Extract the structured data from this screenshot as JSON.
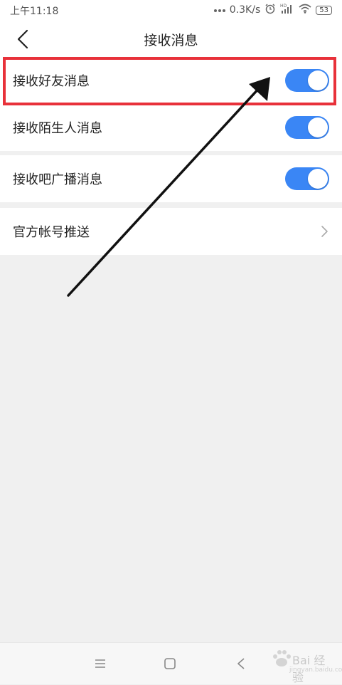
{
  "status_bar": {
    "time": "上午11:18",
    "speed": "0.3K/s",
    "battery": "53",
    "icons": [
      "dots-icon",
      "alarm-icon",
      "hd-signal-icon",
      "wifi-icon",
      "battery-icon"
    ]
  },
  "header": {
    "title": "接收消息",
    "back_icon": "chevron-left-icon"
  },
  "settings": [
    {
      "label": "接收好友消息",
      "control": "toggle",
      "checked": true
    },
    {
      "label": "接收陌生人消息",
      "control": "toggle",
      "checked": true
    },
    {
      "label": "接收吧广播消息",
      "control": "toggle",
      "checked": true
    },
    {
      "label": "官方帐号推送",
      "control": "chevron",
      "icon": "chevron-right-icon"
    }
  ],
  "annotation": {
    "highlight_color": "#e8313a",
    "arrow_color": "#111111"
  },
  "bottom_nav": {
    "icons": [
      "menu-icon",
      "home-square-icon",
      "back-triangle-icon"
    ]
  },
  "watermark": {
    "text": "Bai 经验",
    "sub": "jingyan.baidu.com"
  },
  "colors": {
    "toggle_on": "#3a86f5",
    "background": "#f0f0f0"
  }
}
